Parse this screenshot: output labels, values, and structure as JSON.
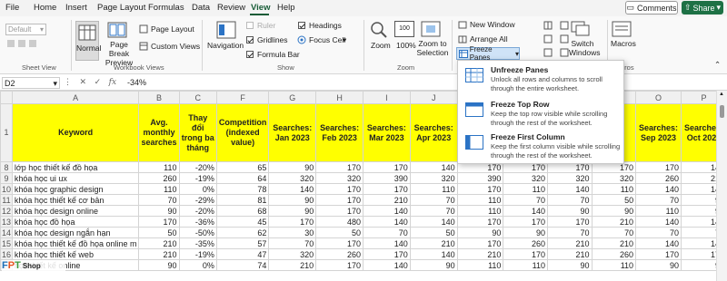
{
  "menu": {
    "tabs": [
      "File",
      "Home",
      "Insert",
      "Page Layout",
      "Formulas",
      "Data",
      "Review",
      "View",
      "Help"
    ],
    "active": "View"
  },
  "actions": {
    "comments": "Comments",
    "share": "Share"
  },
  "ribbon": {
    "sheet_view": {
      "dropdown_value": "Default",
      "label": "Sheet View"
    },
    "workbook_views": {
      "normal": "Normal",
      "page_break_preview": "Page Break Preview",
      "page_layout": "Page Layout",
      "custom_views": "Custom Views",
      "label": "Workbook Views"
    },
    "show": {
      "navigation": "Navigation",
      "ruler": "Ruler",
      "gridlines": "Gridlines",
      "formula_bar": "Formula Bar",
      "headings": "Headings",
      "focus_cell": "Focus Cell",
      "label": "Show",
      "ruler_checked": false,
      "gridlines_checked": true,
      "formula_bar_checked": true,
      "headings_checked": true
    },
    "zoom": {
      "zoom": "Zoom",
      "zoom_100": "100%",
      "zoom_to_selection": "Zoom to Selection",
      "label": "Zoom"
    },
    "window": {
      "new_window": "New Window",
      "arrange_all": "Arrange All",
      "freeze_panes": "Freeze Panes",
      "switch_windows": "Switch Windows"
    },
    "macros": {
      "macros": "Macros",
      "label": "Macros"
    }
  },
  "formula_bar": {
    "name_box": "D2",
    "fx": "fx",
    "value": "-34%"
  },
  "freeze_menu": [
    {
      "title": "Unfreeze Panes",
      "desc": "Unlock all rows and columns to scroll through the entire worksheet."
    },
    {
      "title": "Freeze Top Row",
      "desc": "Keep the top row visible while scrolling through the rest of the worksheet."
    },
    {
      "title": "Freeze First Column",
      "desc": "Keep the first column visible while scrolling through the rest of the worksheet."
    }
  ],
  "sheet": {
    "columns": [
      "A",
      "B",
      "C",
      "F",
      "G",
      "H",
      "I",
      "J",
      "K",
      "L",
      "M",
      "N",
      "O",
      "P"
    ],
    "header_row": "1",
    "headers": [
      "Keyword",
      "Avg. monthly searches",
      "Thay đổi trong ba tháng",
      "Competition (indexed value)",
      "Searches: Jan 2023",
      "Searches: Feb 2023",
      "Searches: Mar 2023",
      "Searches: Apr 2023",
      "Searches: May",
      "",
      "",
      "",
      "Searches: Sep 2023",
      "Searches: Oct 2023"
    ],
    "rows": [
      {
        "n": "8",
        "c": [
          "lớp học thiết kế đồ họa",
          "110",
          "-20%",
          "65",
          "90",
          "170",
          "170",
          "140",
          "170",
          "170",
          "170",
          "170",
          "170",
          "140"
        ]
      },
      {
        "n": "9",
        "c": [
          "khóa học ui ux",
          "260",
          "-19%",
          "64",
          "320",
          "320",
          "390",
          "320",
          "390",
          "320",
          "320",
          "320",
          "260",
          "210"
        ]
      },
      {
        "n": "10",
        "c": [
          "khóa học graphic design",
          "110",
          "0%",
          "78",
          "140",
          "170",
          "170",
          "110",
          "170",
          "110",
          "140",
          "110",
          "140",
          "140"
        ]
      },
      {
        "n": "11",
        "c": [
          "khóa học thiết kế cơ bản",
          "70",
          "-29%",
          "81",
          "90",
          "170",
          "210",
          "70",
          "110",
          "70",
          "70",
          "50",
          "70",
          "90"
        ]
      },
      {
        "n": "12",
        "c": [
          "khóa học design online",
          "90",
          "-20%",
          "68",
          "90",
          "170",
          "140",
          "70",
          "110",
          "140",
          "90",
          "90",
          "110",
          "90"
        ]
      },
      {
        "n": "13",
        "c": [
          "khóa học đồ họa",
          "170",
          "-36%",
          "45",
          "170",
          "480",
          "140",
          "140",
          "170",
          "170",
          "170",
          "210",
          "140",
          "140"
        ]
      },
      {
        "n": "14",
        "c": [
          "khóa học design ngắn hạn",
          "50",
          "-50%",
          "62",
          "30",
          "50",
          "70",
          "50",
          "90",
          "90",
          "70",
          "70",
          "70",
          "70"
        ]
      },
      {
        "n": "15",
        "c": [
          "khóa học thiết kế đồ họa online m",
          "210",
          "-35%",
          "57",
          "70",
          "170",
          "140",
          "210",
          "170",
          "260",
          "210",
          "210",
          "140",
          "140"
        ]
      },
      {
        "n": "16",
        "c": [
          "khóa học thiết kế web",
          "210",
          "-19%",
          "47",
          "320",
          "260",
          "170",
          "140",
          "210",
          "170",
          "210",
          "260",
          "170",
          "170"
        ]
      },
      {
        "n": "17",
        "c": [
          "học thiết kế online",
          "90",
          "0%",
          "74",
          "210",
          "170",
          "140",
          "90",
          "110",
          "110",
          "90",
          "110",
          "90",
          "90"
        ]
      }
    ]
  },
  "logo": {
    "text": "FPT Shop"
  }
}
